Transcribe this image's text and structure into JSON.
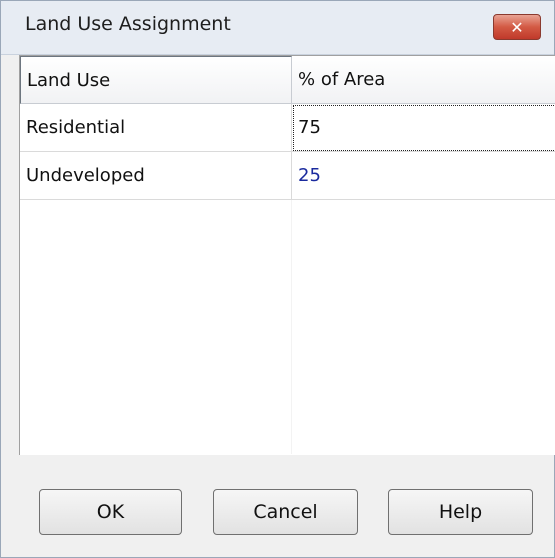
{
  "window": {
    "title": "Land Use Assignment",
    "close_label": "✕"
  },
  "table": {
    "columns": [
      "Land Use",
      "% of Area"
    ],
    "rows": [
      {
        "land_use": "Residential",
        "percent": "75"
      },
      {
        "land_use": "Undeveloped",
        "percent": "25"
      }
    ]
  },
  "buttons": {
    "ok": "OK",
    "cancel": "Cancel",
    "help": "Help"
  }
}
